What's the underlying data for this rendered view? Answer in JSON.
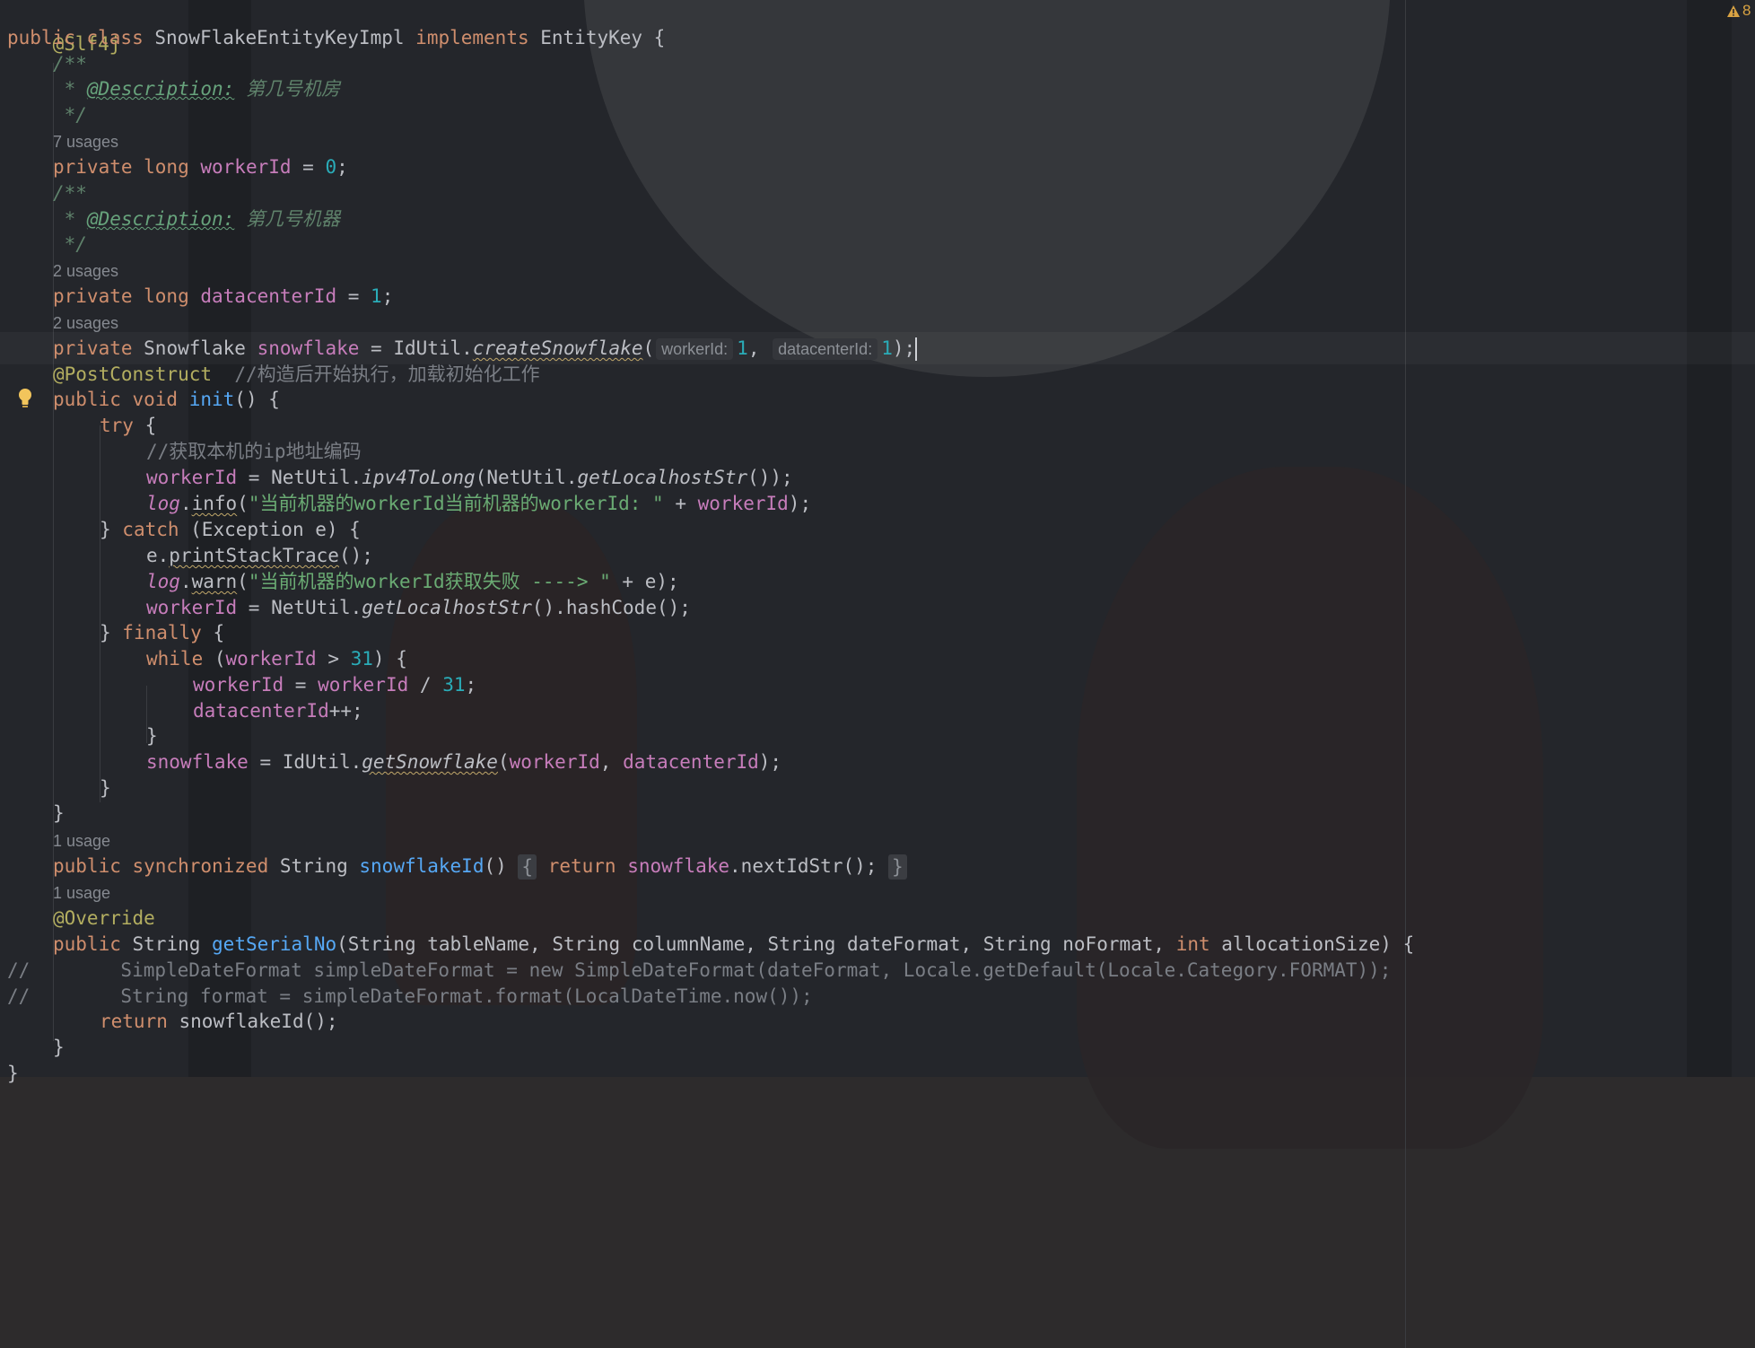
{
  "editor": {
    "line1": "@Slf4j",
    "line2": "public class SnowFlakeEntityKeyImpl implements EntityKey {",
    "line3": "/**",
    "line4": " * @Description: 第几号机房",
    "line5": " */",
    "usage1": "7 usages",
    "line7": "private long workerId = 0;",
    "line8": "/**",
    "line9": " * @Description: 第几号机器",
    "line10": " */",
    "usage2": "2 usages",
    "line12": "private long datacenterId = 1;",
    "usage3": "2 usages",
    "line14": "private Snowflake snowflake = IdUtil.createSnowflake( workerId: 1, datacenterId: 1);",
    "hint_workerId": "workerId:",
    "hint_datacenterId": "datacenterId:",
    "line15": "@PostConstruct  //构造后开始执行，加载初始化工作",
    "line16": "public void init() {",
    "line17": "try {",
    "line18": "//获取本机的ip地址编码",
    "line19": "workerId = NetUtil.ipv4ToLong(NetUtil.getLocalhostStr());",
    "line20": "log.info(\"当前机器的workerId当前机器的workerId: \" + workerId);",
    "line21": "} catch (Exception e) {",
    "line22": "e.printStackTrace();",
    "line23": "log.warn(\"当前机器的workerId获取失败 ----> \" + e);",
    "line24": "workerId = NetUtil.getLocalhostStr().hashCode();",
    "line25": "} finally {",
    "line26": "while (workerId > 31) {",
    "line27": "workerId = workerId / 31;",
    "line28": "datacenterId++;",
    "line29": "}",
    "line30": "snowflake = IdUtil.getSnowflake(workerId, datacenterId);",
    "line31": "}",
    "line32": "}",
    "usage4": "1 usage",
    "line34": "public synchronized String snowflakeId() { return snowflake.nextIdStr(); }",
    "usage5": "1 usage",
    "line36": "@Override",
    "line37": "public String getSerialNo(String tableName, String columnName, String dateFormat, String noFormat, int allocationSize) {",
    "line38": "//        SimpleDateFormat simpleDateFormat = new SimpleDateFormat(dateFormat, Locale.getDefault(Locale.Category.FORMAT));",
    "line39": "//        String format = simpleDateFormat.format(LocalDateTime.now());",
    "line40": "return snowflakeId();",
    "line41": "}",
    "line42": "}"
  },
  "status": {
    "warning_count": "8"
  },
  "icons": {
    "bulb": "lightbulb-icon",
    "warning": "warning-icon"
  },
  "colors": {
    "keyword": "#cf8e6d",
    "annotation": "#b3ae60",
    "number": "#2aacb8",
    "field": "#c77dbb",
    "string": "#6aab73",
    "comment": "#7a7e85",
    "method": "#56a8f5"
  }
}
